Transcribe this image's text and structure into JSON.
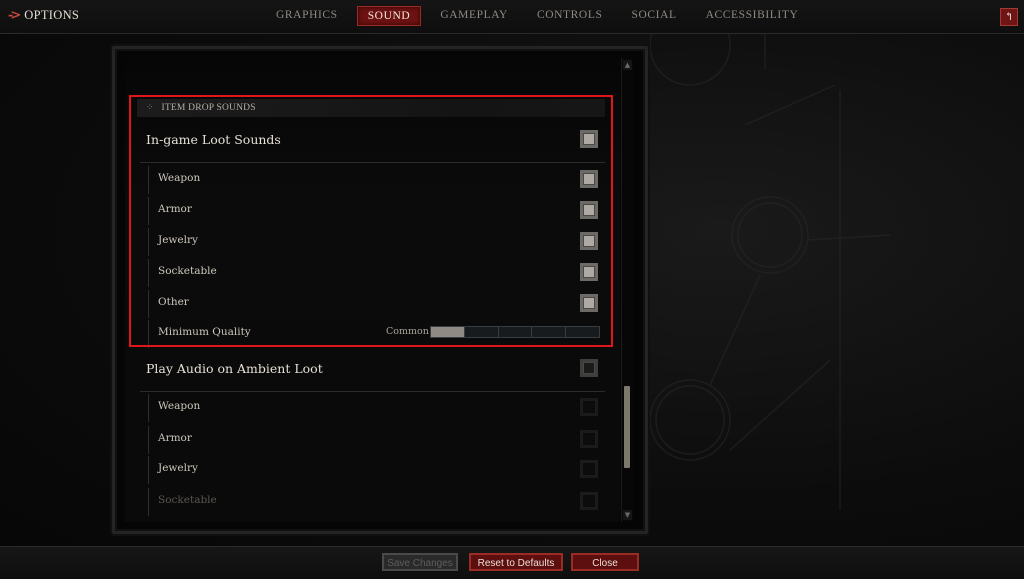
{
  "header": {
    "title": "OPTIONS",
    "title_icon": "arrow-right-icon",
    "tabs": [
      {
        "label": "GRAPHICS",
        "active": false
      },
      {
        "label": "SOUND",
        "active": true
      },
      {
        "label": "GAMEPLAY",
        "active": false
      },
      {
        "label": "CONTROLS",
        "active": false
      },
      {
        "label": "SOCIAL",
        "active": false
      },
      {
        "label": "ACCESSIBILITY",
        "active": false
      }
    ],
    "back_icon": "return-arrow-icon",
    "back_glyph": "↰"
  },
  "section": {
    "title": "ITEM DROP SOUNDS",
    "icon": "dots-icon",
    "icon_glyph": "⁘"
  },
  "in_game_loot": {
    "label": "In-game Loot Sounds",
    "checked": true,
    "items": [
      {
        "label": "Weapon",
        "checked": true
      },
      {
        "label": "Armor",
        "checked": true
      },
      {
        "label": "Jewelry",
        "checked": true
      },
      {
        "label": "Socketable",
        "checked": true
      },
      {
        "label": "Other",
        "checked": true
      }
    ],
    "minimum_quality": {
      "label": "Minimum Quality",
      "value": "Common",
      "level": 1,
      "levels": 5
    }
  },
  "ambient_loot": {
    "label": "Play Audio on Ambient Loot",
    "checked": false,
    "items": [
      {
        "label": "Weapon",
        "checked": false
      },
      {
        "label": "Armor",
        "checked": false
      },
      {
        "label": "Jewelry",
        "checked": false
      },
      {
        "label": "Socketable",
        "checked": false
      }
    ]
  },
  "scrollbar": {
    "up_glyph": "▲",
    "down_glyph": "▼"
  },
  "footer": {
    "save_label": "Save Changes",
    "reset_label": "Reset to Defaults",
    "close_label": "Close"
  },
  "colors": {
    "accent_red": "#6d1212",
    "highlight_border": "#e0161a"
  }
}
